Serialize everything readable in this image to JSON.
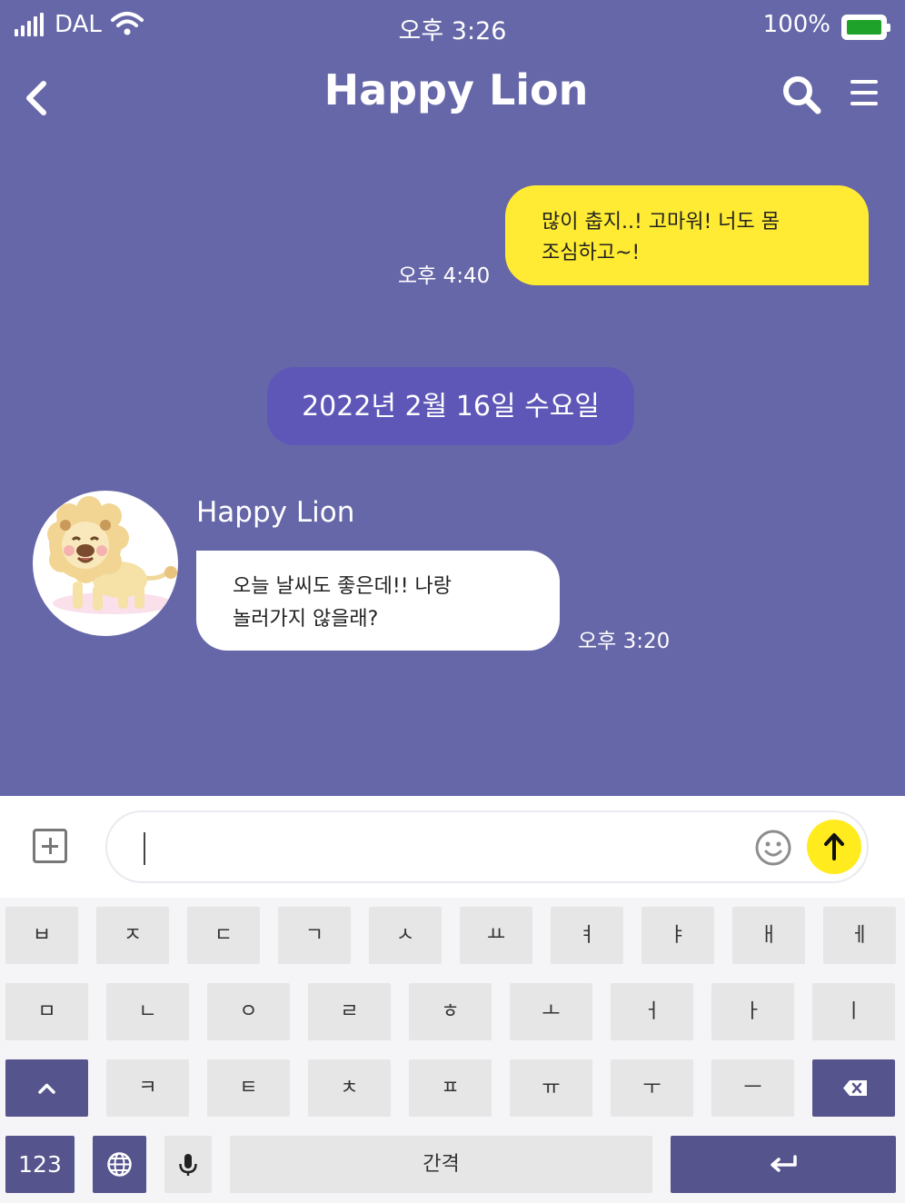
{
  "status_bar": {
    "carrier": "DAL",
    "time": "오후 3:26",
    "battery_percent": "100%",
    "battery_level": 1.0,
    "battery_color": "#1fa22a"
  },
  "header": {
    "title": "Happy Lion"
  },
  "messages": [
    {
      "type": "outgoing",
      "lines": [
        "많이 춥지..! 고마워! 너도 몸",
        "조심하고~!"
      ],
      "time": "오후 4:40"
    },
    {
      "type": "date_divider",
      "text": "2022년 2월 16일 수요일"
    },
    {
      "type": "incoming",
      "sender": "Happy Lion",
      "lines": [
        "오늘 날씨도 좋은데!! 나랑",
        "놀러가지 않을래?"
      ],
      "time": "오후 3:20"
    }
  ],
  "input": {
    "value": "",
    "placeholder": ""
  },
  "keyboard": {
    "row1": [
      "ㅂ",
      "ㅈ",
      "ㄷ",
      "ㄱ",
      "ㅅ",
      "ㅛ",
      "ㅕ",
      "ㅑ",
      "ㅐ",
      "ㅔ"
    ],
    "row2": [
      "ㅁ",
      "ㄴ",
      "ㅇ",
      "ㄹ",
      "ㅎ",
      "ㅗ",
      "ㅓ",
      "ㅏ",
      "ㅣ"
    ],
    "row3": [
      "ㅋ",
      "ㅌ",
      "ㅊ",
      "ㅍ",
      "ㅠ",
      "ㅜ",
      "ㅡ"
    ],
    "numbers_label": "123",
    "space_label": "간격"
  },
  "colors": {
    "background": "#6667a8",
    "my_bubble": "#ffeb33",
    "date_pill": "#5e57b7",
    "send_button": "#ffeb1e",
    "keyboard_dark_key": "#55548d"
  },
  "icons": {
    "back": "chevron-left-icon",
    "search": "search-icon",
    "menu": "hamburger-menu-icon",
    "attach": "plus-square-icon",
    "emoji": "smiley-icon",
    "send": "arrow-up-icon",
    "shift": "chevron-up-icon",
    "globe": "globe-icon",
    "mic": "microphone-icon",
    "backspace": "backspace-icon",
    "enter": "return-arrow-icon"
  }
}
